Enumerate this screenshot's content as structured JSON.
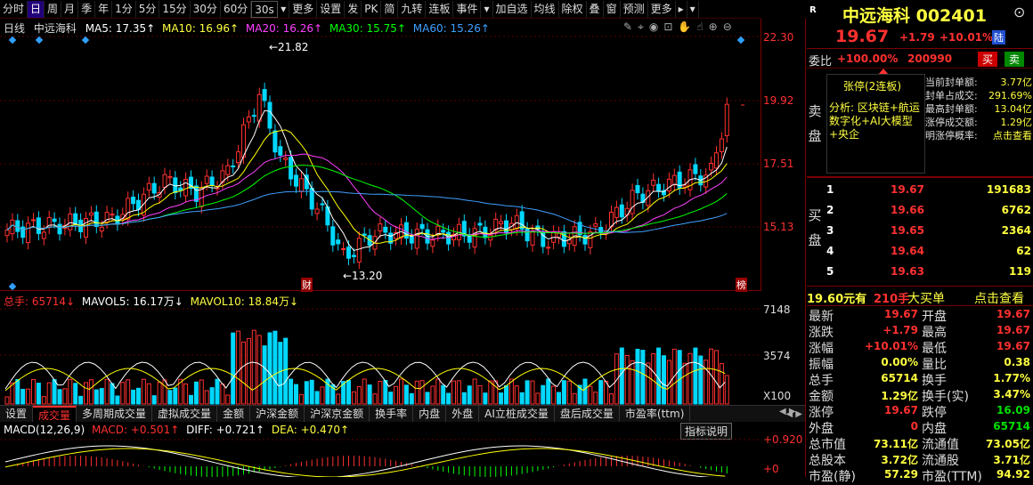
{
  "toolbar": {
    "items": [
      "分时",
      "日",
      "周",
      "月",
      "季",
      "年",
      "1分",
      "5分",
      "15分",
      "30分",
      "60分",
      "30s",
      "▾",
      "更多",
      "设置",
      "发",
      "PK",
      "简",
      "九转",
      "连板",
      "事件",
      "▾",
      "加自选",
      "均线",
      "除权",
      "叠",
      "窗",
      "预测",
      "更多",
      "▸",
      "▾"
    ]
  },
  "main": {
    "period": "日线",
    "stock": "中远海科",
    "ma5": "MA5: 17.35↑",
    "ma10": "MA10: 16.96↑",
    "ma20": "MA20: 16.26↑",
    "ma30": "MA30: 15.75↑",
    "ma60": "MA60: 15.26↑",
    "high_label": "←21.82",
    "low_label": "←13.20",
    "marker_cai": "财",
    "marker_bang": "榜"
  },
  "volume": {
    "total": "总手: 65714↓",
    "mavol5": "MAVOL5: 16.17万↓",
    "mavol10": "MAVOL10: 18.84万↓"
  },
  "axis": {
    "p1": "22.30",
    "p2": "19.92",
    "p3": "17.51",
    "p4": "15.13",
    "v1": "7148",
    "v2": "3574",
    "vunit": "X100",
    "m1": "+0.920",
    "m2": "+0"
  },
  "tabs": [
    "设置",
    "成交量",
    "多周期成交量",
    "虚拟成交量",
    "金额",
    "沪深金额",
    "沪深京金额",
    "换手率",
    "内盘",
    "外盘",
    "AI立桩成交量",
    "盘后成交量",
    "市盈率(ttm)"
  ],
  "macd": {
    "params": "MACD(12,26,9)",
    "macd": "MACD: +0.501↑",
    "diff": "DIFF: +0.721↑",
    "dea": "DEA: +0.470↑",
    "help": "指标说明"
  },
  "colors": {
    "up": "#ff3030",
    "down": "#00d8ff",
    "ma5": "#ffffff",
    "ma10": "#ffff00",
    "ma20": "#ff40ff",
    "ma30": "#00ff00",
    "ma60": "#40a0ff",
    "accent": "#ff3030"
  },
  "side": {
    "title": "中远海科 002401",
    "price": "19.67",
    "change": "+1.79",
    "pct": "+10.01%",
    "market": "陆",
    "weibi_label": "委比",
    "weibi": "+100.00%",
    "weicha": "200990",
    "sell_btn": "买",
    "buy_btn": "卖",
    "sell_label": "卖盘",
    "limit_title": "张停(2连板)",
    "analysis": "分析: 区块链+航运数字化+AI大模型+央企",
    "stats": [
      {
        "k": "当前封单额:",
        "v": "3.77亿"
      },
      {
        "k": "封单占成交:",
        "v": "291.69%"
      },
      {
        "k": "最高封单额:",
        "v": "13.04亿"
      },
      {
        "k": "涨停成交额:",
        "v": "1.29亿"
      },
      {
        "k": "明涨停概率:",
        "v": "点击查看"
      }
    ],
    "buy_label": "买盘",
    "bids": [
      {
        "n": "1",
        "p": "19.67",
        "v": "191683"
      },
      {
        "n": "2",
        "p": "19.66",
        "v": "6762"
      },
      {
        "n": "3",
        "p": "19.65",
        "v": "2364"
      },
      {
        "n": "4",
        "p": "19.64",
        "v": "62"
      },
      {
        "n": "5",
        "p": "19.63",
        "v": "119"
      }
    ],
    "big": {
      "price": "19.60元有",
      "hands": "210手",
      "label": "大买单",
      "link": "点击查看"
    },
    "quote": [
      {
        "k1": "最新",
        "v1": "19.67",
        "k2": "开盘",
        "v2": "19.67",
        "c1": "red",
        "c2": "red"
      },
      {
        "k1": "涨跌",
        "v1": "+1.79",
        "k2": "最高",
        "v2": "19.67",
        "c1": "red",
        "c2": "red"
      },
      {
        "k1": "涨幅",
        "v1": "+10.01%",
        "k2": "最低",
        "v2": "19.67",
        "c1": "red",
        "c2": "red"
      },
      {
        "k1": "振幅",
        "v1": "0.00%",
        "k2": "量比",
        "v2": "0.38",
        "c1": "yel",
        "c2": "yel"
      },
      {
        "k1": "总手",
        "v1": "65714",
        "k2": "换手",
        "v2": "1.77%",
        "c1": "yel",
        "c2": "yel"
      },
      {
        "k1": "金额",
        "v1": "1.29亿",
        "k2": "换手(实)",
        "v2": "3.47%",
        "c1": "yel",
        "c2": "yel"
      },
      {
        "k1": "涨停",
        "v1": "19.67",
        "k2": "跌停",
        "v2": "16.09",
        "c1": "red",
        "c2": "grn"
      },
      {
        "k1": "外盘",
        "v1": "0",
        "k2": "内盘",
        "v2": "65714",
        "c1": "red",
        "c2": "grn"
      },
      {
        "k1": "总市值",
        "v1": "73.11亿",
        "k2": "流通值",
        "v2": "73.05亿",
        "c1": "yel",
        "c2": "yel"
      },
      {
        "k1": "总股本",
        "v1": "3.72亿",
        "k2": "流通股",
        "v2": "3.71亿",
        "c1": "yel",
        "c2": "yel"
      },
      {
        "k1": "市盈(静)",
        "v1": "57.29",
        "k2": "市盈(TTM)",
        "v2": "94.92",
        "c1": "yel",
        "c2": "yel"
      }
    ]
  }
}
